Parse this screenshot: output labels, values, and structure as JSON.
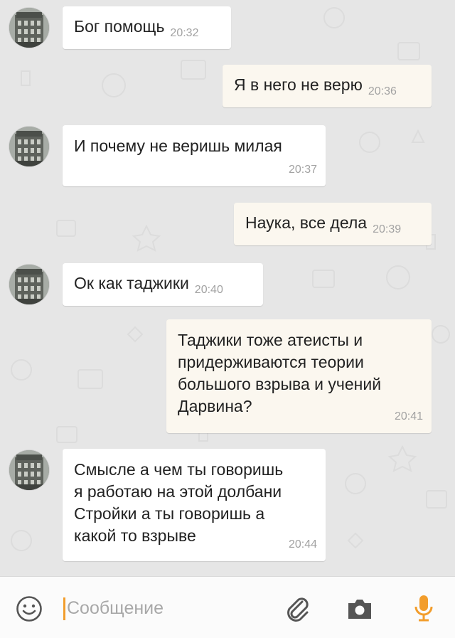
{
  "messages": [
    {
      "direction": "incoming",
      "text": "Бог помощь",
      "time": "20:32"
    },
    {
      "direction": "outgoing",
      "text": "Я в него не верю",
      "time": "20:36"
    },
    {
      "direction": "incoming",
      "text": "И почему не веришь милая",
      "time": "20:37"
    },
    {
      "direction": "outgoing",
      "text": "Наука, все дела",
      "time": "20:39"
    },
    {
      "direction": "incoming",
      "text": "Ок как таджики",
      "time": "20:40"
    },
    {
      "direction": "outgoing",
      "text": "Таджики тоже атеисты и\nпридерживаются теории\nбольшого взрыва и учений\nДарвина?",
      "time": "20:41"
    },
    {
      "direction": "incoming",
      "text": "Смысле а чем ты говоришь\nя работаю на этой долбани\nСтройки а ты говоришь а\nкакой то взрыве",
      "time": "20:44"
    }
  ],
  "input": {
    "placeholder": "Сообщение",
    "value": ""
  },
  "icons": {
    "emoji": "smiley-icon",
    "attach": "paperclip-icon",
    "camera": "camera-icon",
    "mic": "microphone-icon"
  },
  "colors": {
    "accent": "#f29d2c",
    "incoming_bubble": "#ffffff",
    "outgoing_bubble": "#fbf7ef",
    "background": "#e6e6e6"
  }
}
